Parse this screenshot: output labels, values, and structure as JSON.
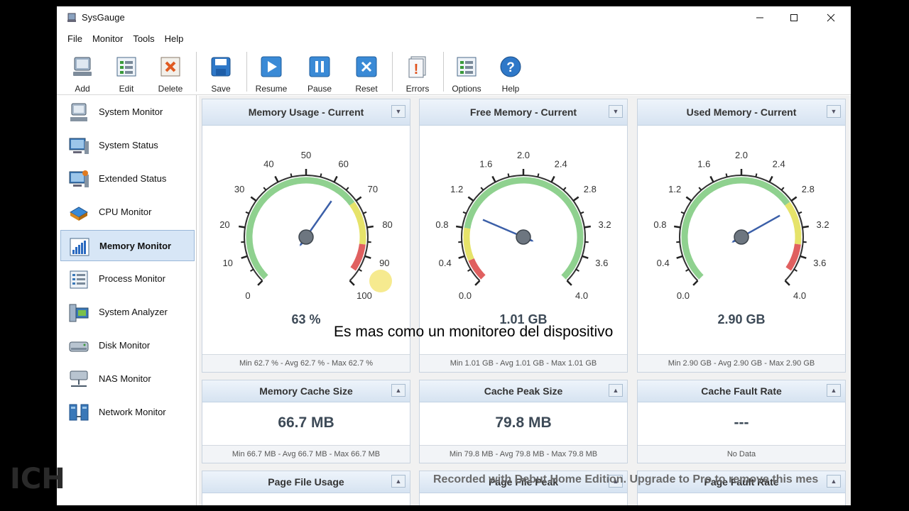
{
  "window": {
    "title": "SysGauge"
  },
  "menu": [
    "File",
    "Monitor",
    "Tools",
    "Help"
  ],
  "toolbar": {
    "add": "Add",
    "edit": "Edit",
    "delete": "Delete",
    "save": "Save",
    "resume": "Resume",
    "pause": "Pause",
    "reset": "Reset",
    "errors": "Errors",
    "options": "Options",
    "help": "Help"
  },
  "sidebar": [
    {
      "label": "System Monitor",
      "icon": "computer-icon"
    },
    {
      "label": "System Status",
      "icon": "monitor-icon"
    },
    {
      "label": "Extended Status",
      "icon": "monitor-plus-icon"
    },
    {
      "label": "CPU Monitor",
      "icon": "cpu-icon"
    },
    {
      "label": "Memory Monitor",
      "icon": "memory-chart-icon",
      "active": true
    },
    {
      "label": "Process Monitor",
      "icon": "list-icon"
    },
    {
      "label": "System Analyzer",
      "icon": "analyzer-icon"
    },
    {
      "label": "Disk Monitor",
      "icon": "disk-icon"
    },
    {
      "label": "NAS Monitor",
      "icon": "nas-icon"
    },
    {
      "label": "Network Monitor",
      "icon": "network-icon"
    }
  ],
  "gauges": [
    {
      "title": "Memory Usage - Current",
      "ticks": [
        "0",
        "10",
        "20",
        "30",
        "40",
        "50",
        "60",
        "70",
        "80",
        "90",
        "100"
      ],
      "min": 0,
      "max": 100,
      "value": 63,
      "display": "63 %",
      "footer": "Min 62.7 % - Avg 62.7 % - Max 62.7 %",
      "zones": "usage"
    },
    {
      "title": "Free Memory - Current",
      "ticks": [
        "0.0",
        "0.4",
        "0.8",
        "1.2",
        "1.6",
        "2.0",
        "2.4",
        "2.8",
        "3.2",
        "3.6",
        "4.0"
      ],
      "min": 0,
      "max": 4,
      "value": 1.01,
      "display": "1.01 GB",
      "footer": "Min 1.01 GB - Avg 1.01 GB - Max 1.01 GB",
      "zones": "free"
    },
    {
      "title": "Used Memory - Current",
      "ticks": [
        "0.0",
        "0.4",
        "0.8",
        "1.2",
        "1.6",
        "2.0",
        "2.4",
        "2.8",
        "3.2",
        "3.6",
        "4.0"
      ],
      "min": 0,
      "max": 4,
      "value": 2.9,
      "display": "2.90 GB",
      "footer": "Min 2.90 GB - Avg 2.90 GB - Max 2.90 GB",
      "zones": "usage"
    }
  ],
  "counters": [
    {
      "title": "Memory Cache Size",
      "value": "66.7 MB",
      "footer": "Min 66.7 MB - Avg 66.7 MB - Max 66.7 MB"
    },
    {
      "title": "Cache Peak Size",
      "value": "79.8 MB",
      "footer": "Min 79.8 MB - Avg 79.8 MB - Max 79.8 MB"
    },
    {
      "title": "Cache Fault Rate",
      "value": "---",
      "footer": "No Data"
    }
  ],
  "bottom_row": [
    {
      "title": "Page File Usage"
    },
    {
      "title": "Page File Peak"
    },
    {
      "title": "Page Fault Rate"
    }
  ],
  "caption": "Es mas como un monitoreo del dispositivo",
  "watermark": "Recorded with Debut Home Edition. Upgrade to Pro to remove this mes",
  "colors": {
    "green": "#8fd18f",
    "yellow": "#e6e36a",
    "red": "#e06060",
    "needle": "#3b5fa8"
  }
}
